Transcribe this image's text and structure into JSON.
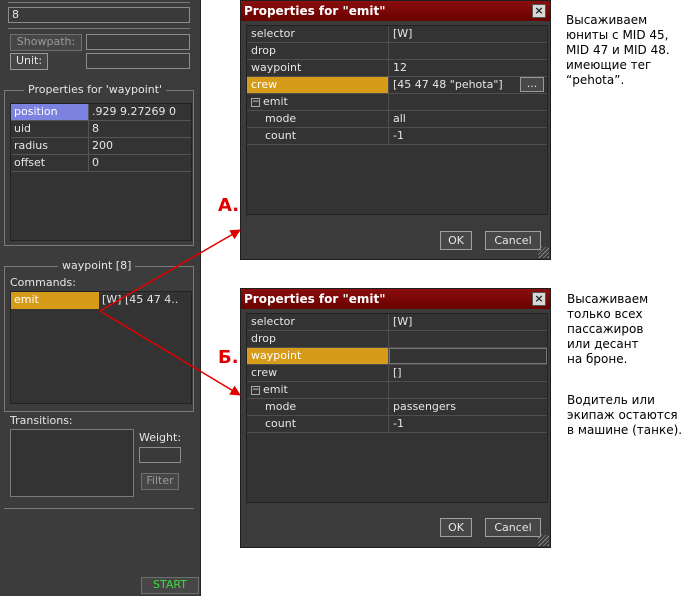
{
  "left_panel": {
    "top_field": "8",
    "showpath_button": "Showpath:",
    "unit_button": "Unit:",
    "props_title": "Properties for 'waypoint'",
    "props_rows": [
      {
        "key": "position",
        "value": ".929 9.27269 0"
      },
      {
        "key": "uid",
        "value": "8"
      },
      {
        "key": "radius",
        "value": "200"
      },
      {
        "key": "offset",
        "value": "0"
      }
    ],
    "waypoint_title": "waypoint [8]",
    "commands_label": "Commands:",
    "command": {
      "name": "emit",
      "value": "[W] [45 47 4.."
    },
    "transitions_label": "Transitions:",
    "weight_label": "Weight:",
    "filter_button": "Filter",
    "start_button": "START"
  },
  "dialog_a": {
    "title": "Properties for \"emit\"",
    "close": "×",
    "rows": [
      {
        "key": "selector",
        "value": "[W]"
      },
      {
        "key": "drop",
        "value": ""
      },
      {
        "key": "waypoint",
        "value": "12"
      },
      {
        "key": "crew",
        "value": "[45 47 48 \"pehota\"]"
      },
      {
        "key": "emit",
        "value": ""
      },
      {
        "key": "mode",
        "value": "all"
      },
      {
        "key": "count",
        "value": "-1"
      }
    ],
    "dots_button": "...",
    "ok": "OK",
    "cancel": "Cancel"
  },
  "dialog_b": {
    "title": "Properties for \"emit\"",
    "close": "×",
    "rows": [
      {
        "key": "selector",
        "value": "[W]"
      },
      {
        "key": "drop",
        "value": ""
      },
      {
        "key": "waypoint",
        "value": ""
      },
      {
        "key": "crew",
        "value": "[]"
      },
      {
        "key": "emit",
        "value": ""
      },
      {
        "key": "mode",
        "value": "passengers"
      },
      {
        "key": "count",
        "value": "-1"
      }
    ],
    "ok": "OK",
    "cancel": "Cancel"
  },
  "annotations": {
    "marker_a": "A.",
    "marker_b": "Б.",
    "note_a": "Высаживаем\nюниты с MID 45,\nMID 47 и MID 48.\nимеющие тег\n“pehota”.",
    "note_b1": "Высаживаем\nтолько всех\nпассажиров\nили десант\nна броне.",
    "note_b2": "Водитель или\nэкипаж остаются\nв машине (танке)."
  },
  "colors": {
    "panel_bg": "#3c3c3c",
    "title_bar": "#7a0000",
    "selection_orange": "#d59b19",
    "selection_blue": "#7c82e0",
    "start_text": "#3ddc3d",
    "arrow": "#e00000"
  }
}
